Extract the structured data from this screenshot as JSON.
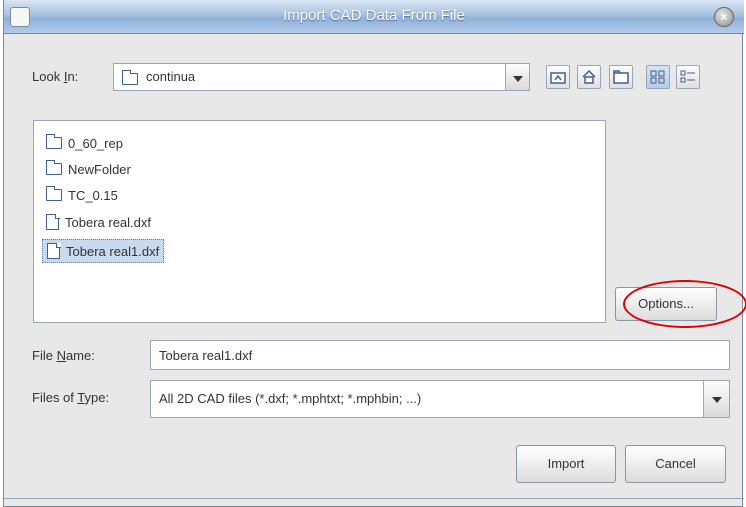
{
  "window": {
    "title": "Import CAD Data From File",
    "close_glyph": "×"
  },
  "look_in": {
    "label_pre": "Look ",
    "label_key": "I",
    "label_post": "n:",
    "value": "continua"
  },
  "toolbar": {
    "icons": [
      "up-one-level-icon",
      "home-icon",
      "new-folder-icon",
      "list-view-icon",
      "details-view-icon"
    ]
  },
  "files": [
    {
      "name": "0_60_rep",
      "type": "folder"
    },
    {
      "name": "NewFolder",
      "type": "folder"
    },
    {
      "name": "TC_0.15",
      "type": "folder"
    },
    {
      "name": "Tobera real.dxf",
      "type": "file"
    },
    {
      "name": "Tobera real1.dxf",
      "type": "file",
      "selected": true
    }
  ],
  "options_button": "Options...",
  "file_name": {
    "label_pre": "File ",
    "label_key": "N",
    "label_post": "ame:",
    "value": "Tobera real1.dxf"
  },
  "files_of_type": {
    "label_pre": "Files of ",
    "label_key": "T",
    "label_post": "ype:",
    "value": "All 2D CAD files (*.dxf; *.mphtxt; *.mphbin; ...)"
  },
  "buttons": {
    "import": "Import",
    "cancel": "Cancel"
  },
  "colors": {
    "title_gradient": "#8fb0d8",
    "selection": "#c9daf0",
    "highlight": "#e00000"
  }
}
